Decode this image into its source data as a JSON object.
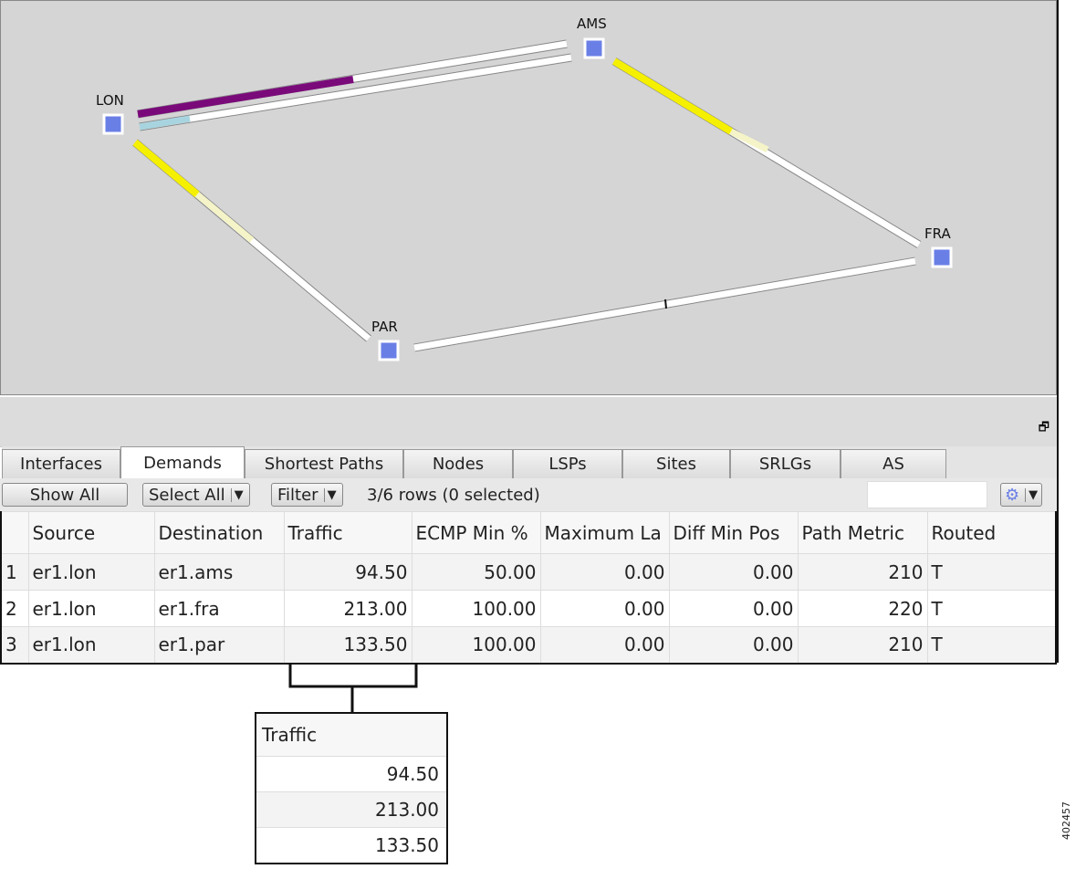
{
  "map": {
    "nodes": [
      "LON",
      "AMS",
      "FRA",
      "PAR"
    ]
  },
  "tabs": [
    "Interfaces",
    "Demands",
    "Shortest Paths",
    "Nodes",
    "LSPs",
    "Sites",
    "SRLGs",
    "AS"
  ],
  "active_tab": "Demands",
  "toolbar": {
    "show_all": "Show All",
    "select_all": "Select All",
    "filter": "Filter",
    "status": "3/6 rows (0 selected)",
    "dropdown": "▼"
  },
  "table": {
    "columns": [
      "",
      "Source",
      "Destination",
      "Traffic",
      "ECMP Min %",
      "Maximum La",
      "Diff Min Pos",
      "Path Metric",
      "Routed"
    ],
    "rows": [
      [
        "1",
        "er1.lon",
        "er1.ams",
        "94.50",
        "50.00",
        "0.00",
        "0.00",
        "210",
        "T"
      ],
      [
        "2",
        "er1.lon",
        "er1.fra",
        "213.00",
        "100.00",
        "0.00",
        "0.00",
        "220",
        "T"
      ],
      [
        "3",
        "er1.lon",
        "er1.par",
        "133.50",
        "100.00",
        "0.00",
        "0.00",
        "210",
        "T"
      ]
    ]
  },
  "callout": {
    "header": "Traffic",
    "values": [
      "94.50",
      "213.00",
      "133.50"
    ]
  },
  "figure_id": "402457",
  "colors": {
    "node": "#6a7fe6",
    "purple": "#7a0a7a",
    "yellow": "#f5f000",
    "lightblue": "#a8d4e0"
  }
}
